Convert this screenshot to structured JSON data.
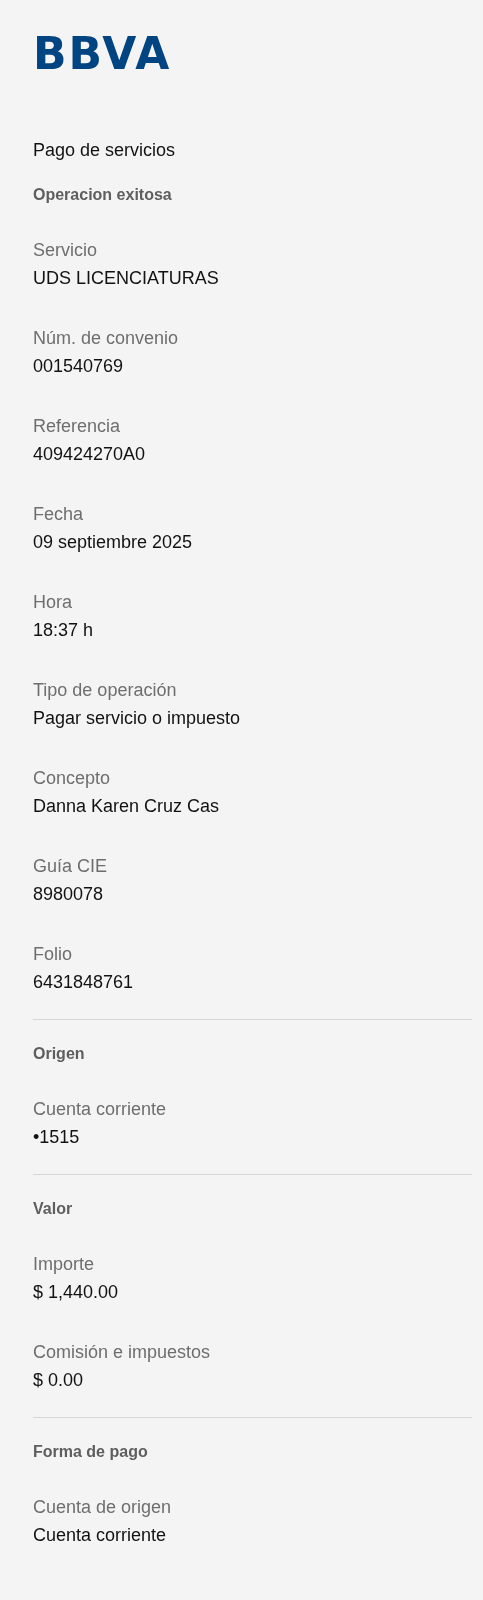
{
  "logo": "BBVA",
  "title": "Pago de servicios",
  "sections": [
    {
      "heading": "Operacion exitosa",
      "fields": [
        {
          "label": "Servicio",
          "value": "UDS LICENCIATURAS"
        },
        {
          "label": "Núm. de convenio",
          "value": "001540769"
        },
        {
          "label": "Referencia",
          "value": "409424270A0"
        },
        {
          "label": "Fecha",
          "value": "09 septiembre 2025"
        },
        {
          "label": "Hora",
          "value": "18:37 h"
        },
        {
          "label": "Tipo de operación",
          "value": "Pagar servicio o impuesto"
        },
        {
          "label": "Concepto",
          "value": "Danna Karen Cruz Cas"
        },
        {
          "label": "Guía CIE",
          "value": "8980078"
        },
        {
          "label": "Folio",
          "value": "6431848761"
        }
      ]
    },
    {
      "heading": "Origen",
      "fields": [
        {
          "label": "Cuenta corriente",
          "value": "•1515"
        }
      ]
    },
    {
      "heading": "Valor",
      "fields": [
        {
          "label": "Importe",
          "value": "$ 1,440.00"
        },
        {
          "label": "Comisión e impuestos",
          "value": "$ 0.00"
        }
      ]
    },
    {
      "heading": "Forma de pago",
      "fields": [
        {
          "label": "Cuenta de origen",
          "value": "Cuenta corriente"
        }
      ]
    }
  ]
}
